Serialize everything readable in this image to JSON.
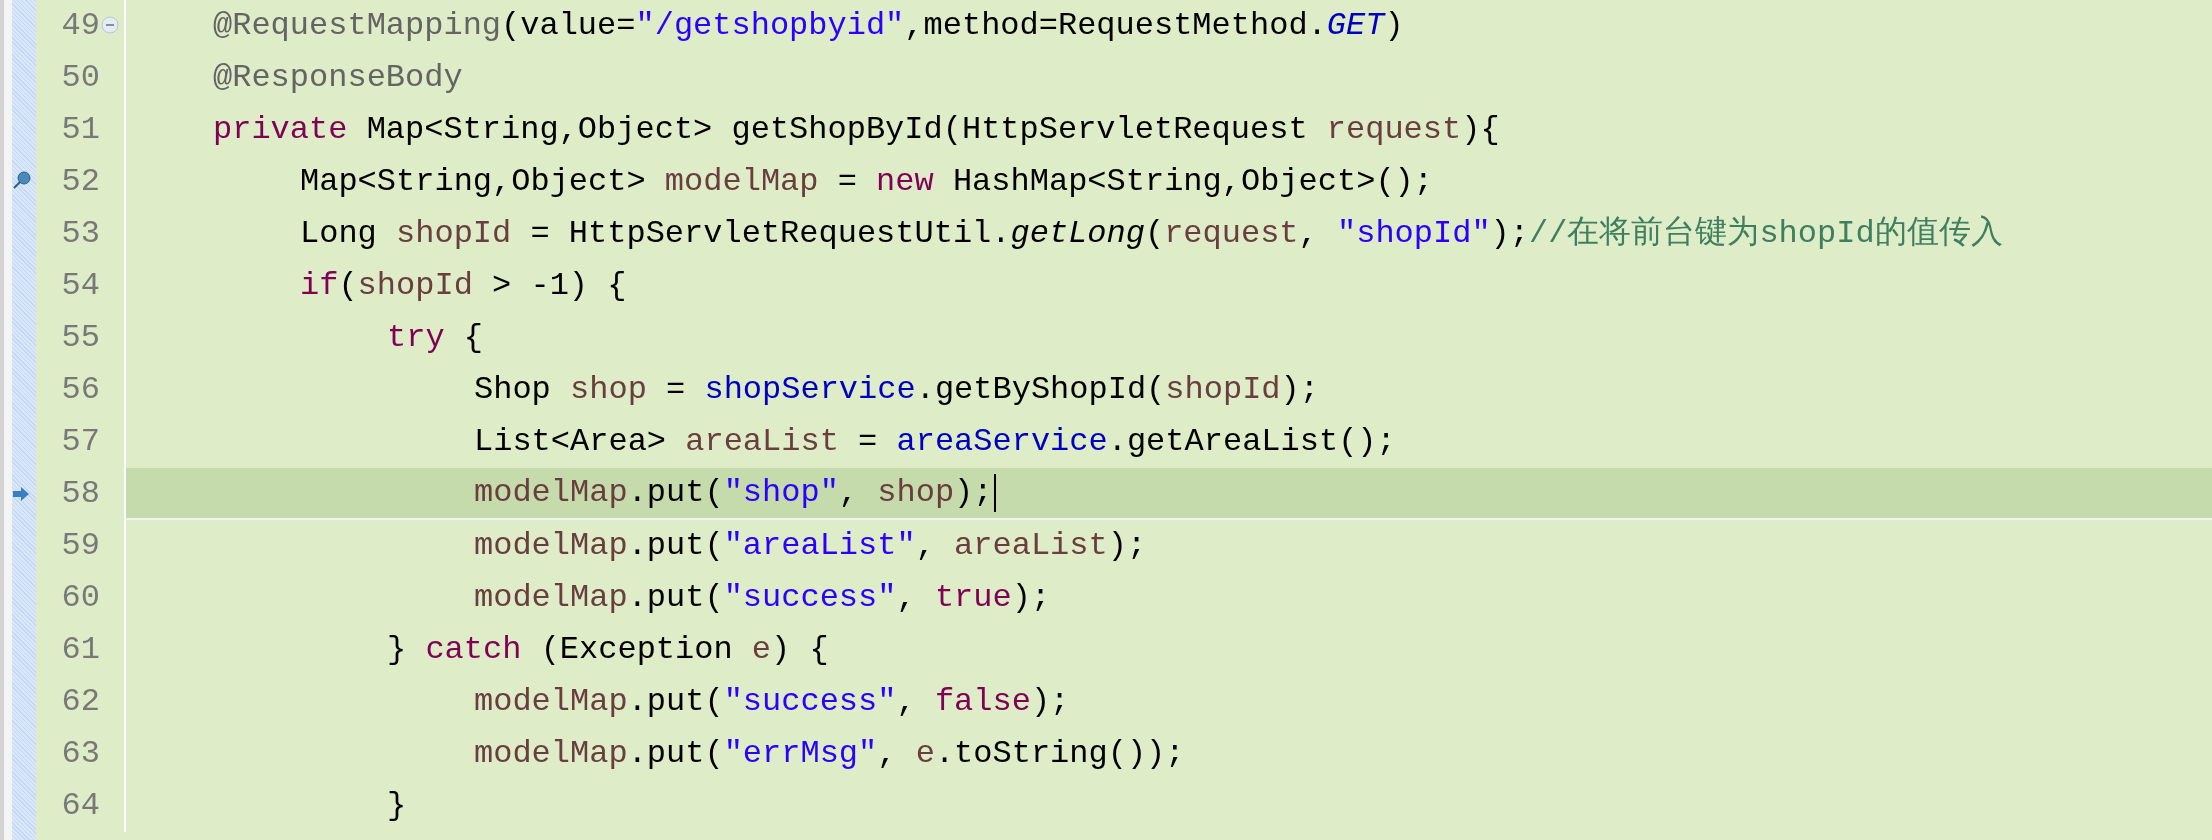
{
  "editor": {
    "lines": [
      {
        "number": "49",
        "current": false,
        "fold": {
          "kind": "toggle",
          "expanded": true
        },
        "tokens": [
          {
            "kind": "annotation",
            "text": "@RequestMapping"
          },
          {
            "kind": "plain",
            "text": "(value="
          },
          {
            "kind": "string",
            "text": "\"/getshopbyid\""
          },
          {
            "kind": "plain",
            "text": ",method=RequestMethod."
          },
          {
            "kind": "static",
            "text": "GET"
          },
          {
            "kind": "plain",
            "text": ")"
          }
        ]
      },
      {
        "number": "50",
        "current": false,
        "tokens": [
          {
            "kind": "annotation",
            "text": "@ResponseBody"
          }
        ]
      },
      {
        "number": "51",
        "current": false,
        "tokens": [
          {
            "kind": "keyword",
            "text": "private"
          },
          {
            "kind": "plain",
            "text": " Map<String,Object> getShopById(HttpServletRequest "
          },
          {
            "kind": "local",
            "text": "request"
          },
          {
            "kind": "plain",
            "text": "){"
          }
        ],
        "children": [
          {
            "number": "52",
            "current": false,
            "marker": {
              "kind": "occurrence"
            },
            "tokens": [
              {
                "kind": "plain",
                "text": "Map<String,Object> "
              },
              {
                "kind": "local",
                "text": "modelMap"
              },
              {
                "kind": "plain",
                "text": " = "
              },
              {
                "kind": "keyword",
                "text": "new"
              },
              {
                "kind": "plain",
                "text": " HashMap<String,Object>();"
              }
            ]
          },
          {
            "number": "53",
            "current": false,
            "tokens": [
              {
                "kind": "plain",
                "text": "Long "
              },
              {
                "kind": "local",
                "text": "shopId"
              },
              {
                "kind": "plain",
                "text": " = HttpServletRequestUtil."
              },
              {
                "kind": "static-method",
                "text": "getLong"
              },
              {
                "kind": "plain",
                "text": "("
              },
              {
                "kind": "local",
                "text": "request"
              },
              {
                "kind": "plain",
                "text": ", "
              },
              {
                "kind": "string",
                "text": "\"shopId\""
              },
              {
                "kind": "plain",
                "text": ");"
              },
              {
                "kind": "comment",
                "text": "//在将前台键为shopId的值传入"
              }
            ]
          },
          {
            "number": "54",
            "current": false,
            "tokens": [
              {
                "kind": "keyword",
                "text": "if"
              },
              {
                "kind": "plain",
                "text": "("
              },
              {
                "kind": "local",
                "text": "shopId"
              },
              {
                "kind": "plain",
                "text": " > -1) {"
              }
            ],
            "children": [
              {
                "number": "55",
                "current": false,
                "tokens": [
                  {
                    "kind": "keyword",
                    "text": "try"
                  },
                  {
                    "kind": "plain",
                    "text": " {"
                  }
                ],
                "children": [
                  {
                    "number": "56",
                    "current": false,
                    "tokens": [
                      {
                        "kind": "plain",
                        "text": "Shop "
                      },
                      {
                        "kind": "local",
                        "text": "shop"
                      },
                      {
                        "kind": "plain",
                        "text": " = "
                      },
                      {
                        "kind": "field",
                        "text": "shopService"
                      },
                      {
                        "kind": "plain",
                        "text": ".getByShopId("
                      },
                      {
                        "kind": "local",
                        "text": "shopId"
                      },
                      {
                        "kind": "plain",
                        "text": ");"
                      }
                    ]
                  },
                  {
                    "number": "57",
                    "current": false,
                    "tokens": [
                      {
                        "kind": "plain",
                        "text": "List<Area> "
                      },
                      {
                        "kind": "local",
                        "text": "areaList"
                      },
                      {
                        "kind": "plain",
                        "text": " = "
                      },
                      {
                        "kind": "field",
                        "text": "areaService"
                      },
                      {
                        "kind": "plain",
                        "text": ".getAreaList();"
                      }
                    ]
                  },
                  {
                    "number": "58",
                    "current": true,
                    "marker": {
                      "kind": "current"
                    },
                    "tokens": [
                      {
                        "kind": "local",
                        "text": "modelMap"
                      },
                      {
                        "kind": "plain",
                        "text": ".put("
                      },
                      {
                        "kind": "string",
                        "text": "\"shop\""
                      },
                      {
                        "kind": "plain",
                        "text": ", "
                      },
                      {
                        "kind": "local",
                        "text": "shop"
                      },
                      {
                        "kind": "plain",
                        "text": ");"
                      }
                    ]
                  },
                  {
                    "number": "59",
                    "current": false,
                    "tokens": [
                      {
                        "kind": "local",
                        "text": "modelMap"
                      },
                      {
                        "kind": "plain",
                        "text": ".put("
                      },
                      {
                        "kind": "string",
                        "text": "\"areaList\""
                      },
                      {
                        "kind": "plain",
                        "text": ", "
                      },
                      {
                        "kind": "local",
                        "text": "areaList"
                      },
                      {
                        "kind": "plain",
                        "text": ");"
                      }
                    ]
                  },
                  {
                    "number": "60",
                    "current": false,
                    "tokens": [
                      {
                        "kind": "local",
                        "text": "modelMap"
                      },
                      {
                        "kind": "plain",
                        "text": ".put("
                      },
                      {
                        "kind": "string",
                        "text": "\"success\""
                      },
                      {
                        "kind": "plain",
                        "text": ", "
                      },
                      {
                        "kind": "keyword",
                        "text": "true"
                      },
                      {
                        "kind": "plain",
                        "text": ");"
                      }
                    ]
                  }
                ]
              },
              {
                "number": "61",
                "current": false,
                "tokens": [
                  {
                    "kind": "plain",
                    "text": "} "
                  },
                  {
                    "kind": "keyword",
                    "text": "catch"
                  },
                  {
                    "kind": "plain",
                    "text": " (Exception "
                  },
                  {
                    "kind": "local",
                    "text": "e"
                  },
                  {
                    "kind": "plain",
                    "text": ") {"
                  }
                ],
                "children": [
                  {
                    "number": "62",
                    "current": false,
                    "tokens": [
                      {
                        "kind": "local",
                        "text": "modelMap"
                      },
                      {
                        "kind": "plain",
                        "text": ".put("
                      },
                      {
                        "kind": "string",
                        "text": "\"success\""
                      },
                      {
                        "kind": "plain",
                        "text": ", "
                      },
                      {
                        "kind": "keyword",
                        "text": "false"
                      },
                      {
                        "kind": "plain",
                        "text": ");"
                      }
                    ]
                  },
                  {
                    "number": "63",
                    "current": false,
                    "tokens": [
                      {
                        "kind": "local",
                        "text": "modelMap"
                      },
                      {
                        "kind": "plain",
                        "text": ".put("
                      },
                      {
                        "kind": "string",
                        "text": "\"errMsg\""
                      },
                      {
                        "kind": "plain",
                        "text": ", "
                      },
                      {
                        "kind": "local",
                        "text": "e"
                      },
                      {
                        "kind": "plain",
                        "text": ".toString());"
                      }
                    ]
                  }
                ]
              },
              {
                "number": "64",
                "current": false,
                "tokens": [
                  {
                    "kind": "plain",
                    "text": "}"
                  }
                ]
              }
            ]
          }
        ]
      }
    ]
  }
}
